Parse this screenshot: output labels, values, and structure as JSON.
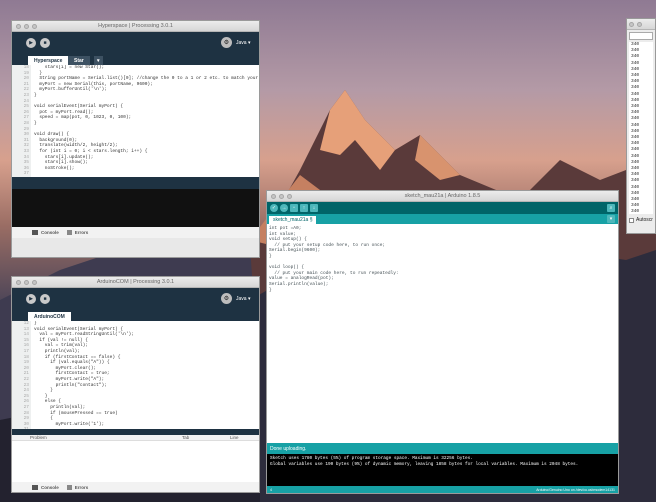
{
  "hyperspace": {
    "title": "Hyperspace | Processing 3.0.1",
    "mode": "Java ▾",
    "tabs": [
      "Hyperspace",
      "Star"
    ],
    "gutter": [
      "18",
      "19",
      "20",
      "21",
      "22",
      "23",
      "24",
      "25",
      "26",
      "27",
      "28",
      "29",
      "30",
      "31",
      "32",
      "33",
      "34",
      "35",
      "36",
      "37"
    ],
    "code": [
      "    stars[i] = new Star();",
      "  }",
      "  String portName = Serial.list()[0]; //change the 0 to a 1 or 2 etc. to match your port",
      "  myPort = new Serial(this, portName, 9600);",
      "  myPort.bufferUntil('\\n');",
      "}",
      "",
      "void serialEvent(Serial myPort) {",
      "  pot = myPort.read();",
      "  speed = map(pot, 0, 1023, 0, 100);",
      "}",
      "",
      "void draw() {",
      "  background(0);",
      "  translate(width/2, height/2);",
      "  for (int i = 0; i < stars.length; i++) {",
      "    stars[i].update();",
      "    stars[i].show();",
      "    noStroke();",
      ""
    ],
    "console_tab": "Console",
    "errors_tab": "Errors"
  },
  "arduinocom": {
    "title": "ArduinoCOM | Processing 3.0.1",
    "mode": "Java ▾",
    "tab": "ArduinoCOM",
    "gutter": [
      "12",
      "13",
      "14",
      "15",
      "16",
      "17",
      "18",
      "19",
      "20",
      "21",
      "22",
      "23",
      "24",
      "25",
      "26",
      "27",
      "28",
      "29",
      "30",
      "31",
      "32"
    ],
    "code": [
      "}",
      "void serialEvent(Serial myPort) {",
      "  val = myPort.readStringUntil('\\n');",
      "  if (val != null) {",
      "    val = trim(val);",
      "    println(val);",
      "    if (firstContact == false) {",
      "      if (val.equals(\"A\")) {",
      "        myPort.clear();",
      "        firstContact = true;",
      "        myPort.write(\"A\");",
      "        println(\"contact\");",
      "      }",
      "    }",
      "    else {",
      "      println(val);",
      "      if (mousePressed == true)",
      "      {",
      "        myPort.write('1');",
      "",
      ""
    ],
    "err_cols": [
      "Problem",
      "Tab",
      "Line"
    ],
    "console_tab": "Console",
    "errors_tab": "Errors"
  },
  "arduino": {
    "title": "sketch_mau21a | Arduino 1.8.5",
    "tab": "sketch_mau21a §",
    "code": [
      "int pot =A0;",
      "int value;",
      "void setup() {",
      "  // put your setup code here, to run once;",
      "Serial.begin(9600);",
      "}",
      "",
      "void loop() {",
      "  // put your main code here, to run repeatedly:",
      "value = analogRead(pot);",
      "Serial.println(value);",
      "}"
    ],
    "status": "Done uploading.",
    "console": [
      "Sketch uses 1780 bytes (5%) of program storage space. Maximum is 32256 bytes.",
      "Global variables use 190 bytes (9%) of dynamic memory, leaving 1858 bytes for local variables. Maximum is 2048 bytes."
    ],
    "footer_left": "4",
    "footer_right": "Arduino/Genuino Uno on /dev/cu.usbmodem14131"
  },
  "serial": {
    "lines": [
      "340",
      "340",
      "340",
      "340",
      "340",
      "340",
      "340",
      "340",
      "340",
      "340",
      "340",
      "340",
      "340",
      "340",
      "340",
      "340",
      "340",
      "340",
      "340",
      "340",
      "340",
      "340",
      "340",
      "340",
      "340",
      "340",
      "340",
      "340"
    ],
    "autoscroll": "Autoscr"
  }
}
